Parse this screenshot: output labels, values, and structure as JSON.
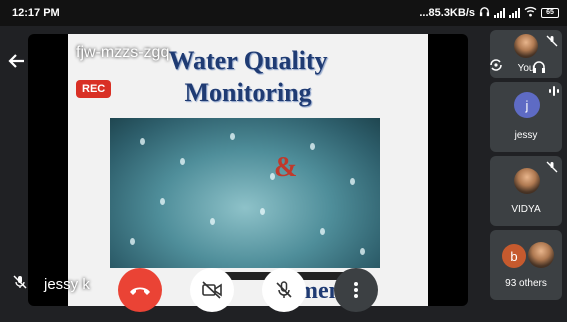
{
  "status_bar": {
    "time": "12:17 PM",
    "net_speed": "...85.3KB/s",
    "battery": "65"
  },
  "meeting": {
    "code": "fjw-mzzs-zgq",
    "rec_label": "REC",
    "presenter_name": "jessy k"
  },
  "slide": {
    "title_line1": "Water Quality",
    "title_line2": "Monitoring",
    "ampersand": "&",
    "bottom_text": "ment"
  },
  "participants": [
    {
      "name": "You",
      "muted": true
    },
    {
      "name": "jessy",
      "initial": "j",
      "speaking": true,
      "avatar_color": "#5e6bc4"
    },
    {
      "name": "VIDYA",
      "muted": true
    },
    {
      "name": "93 others",
      "initial": "b",
      "avatar_color": "#c65a2e"
    }
  ],
  "colors": {
    "end_call": "#ea4335",
    "rec_badge": "#d93025",
    "tile_bg": "#3c4043",
    "slide_title": "#1f3b73"
  }
}
